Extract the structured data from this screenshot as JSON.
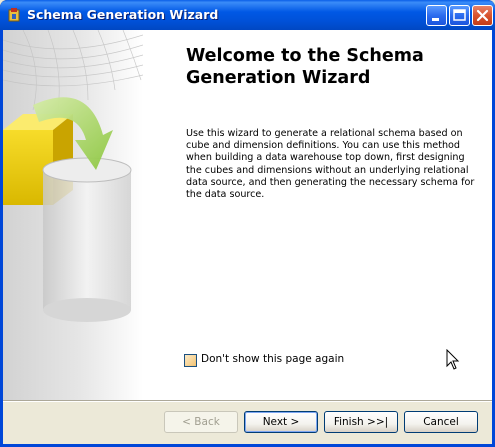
{
  "window": {
    "title": "Schema Generation Wizard",
    "buttons": {
      "minimize": "minimize-icon",
      "maximize": "maximize-icon",
      "close": "close-icon"
    }
  },
  "page": {
    "heading_line1": "Welcome to the Schema",
    "heading_line2": "Generation Wizard",
    "description": "Use this wizard to generate a relational schema based on cube and dimension definitions. You can use this method when building a data warehouse top down, first designing the cubes and dimensions without an underlying relational data source, and then generating the necessary schema for the data source.",
    "dont_show_label": "Don't show this page again",
    "dont_show_checked": false
  },
  "footer": {
    "back_label": "< Back",
    "next_label": "Next >",
    "finish_label": "Finish >>|",
    "cancel_label": "Cancel"
  },
  "colors": {
    "titlebar": "#0054E3",
    "dialog_bg": "#ECE9D8",
    "panel_bg": "#FFFFFF",
    "accent_green": "#8CC63F",
    "cube_yellow": "#F2D100"
  }
}
